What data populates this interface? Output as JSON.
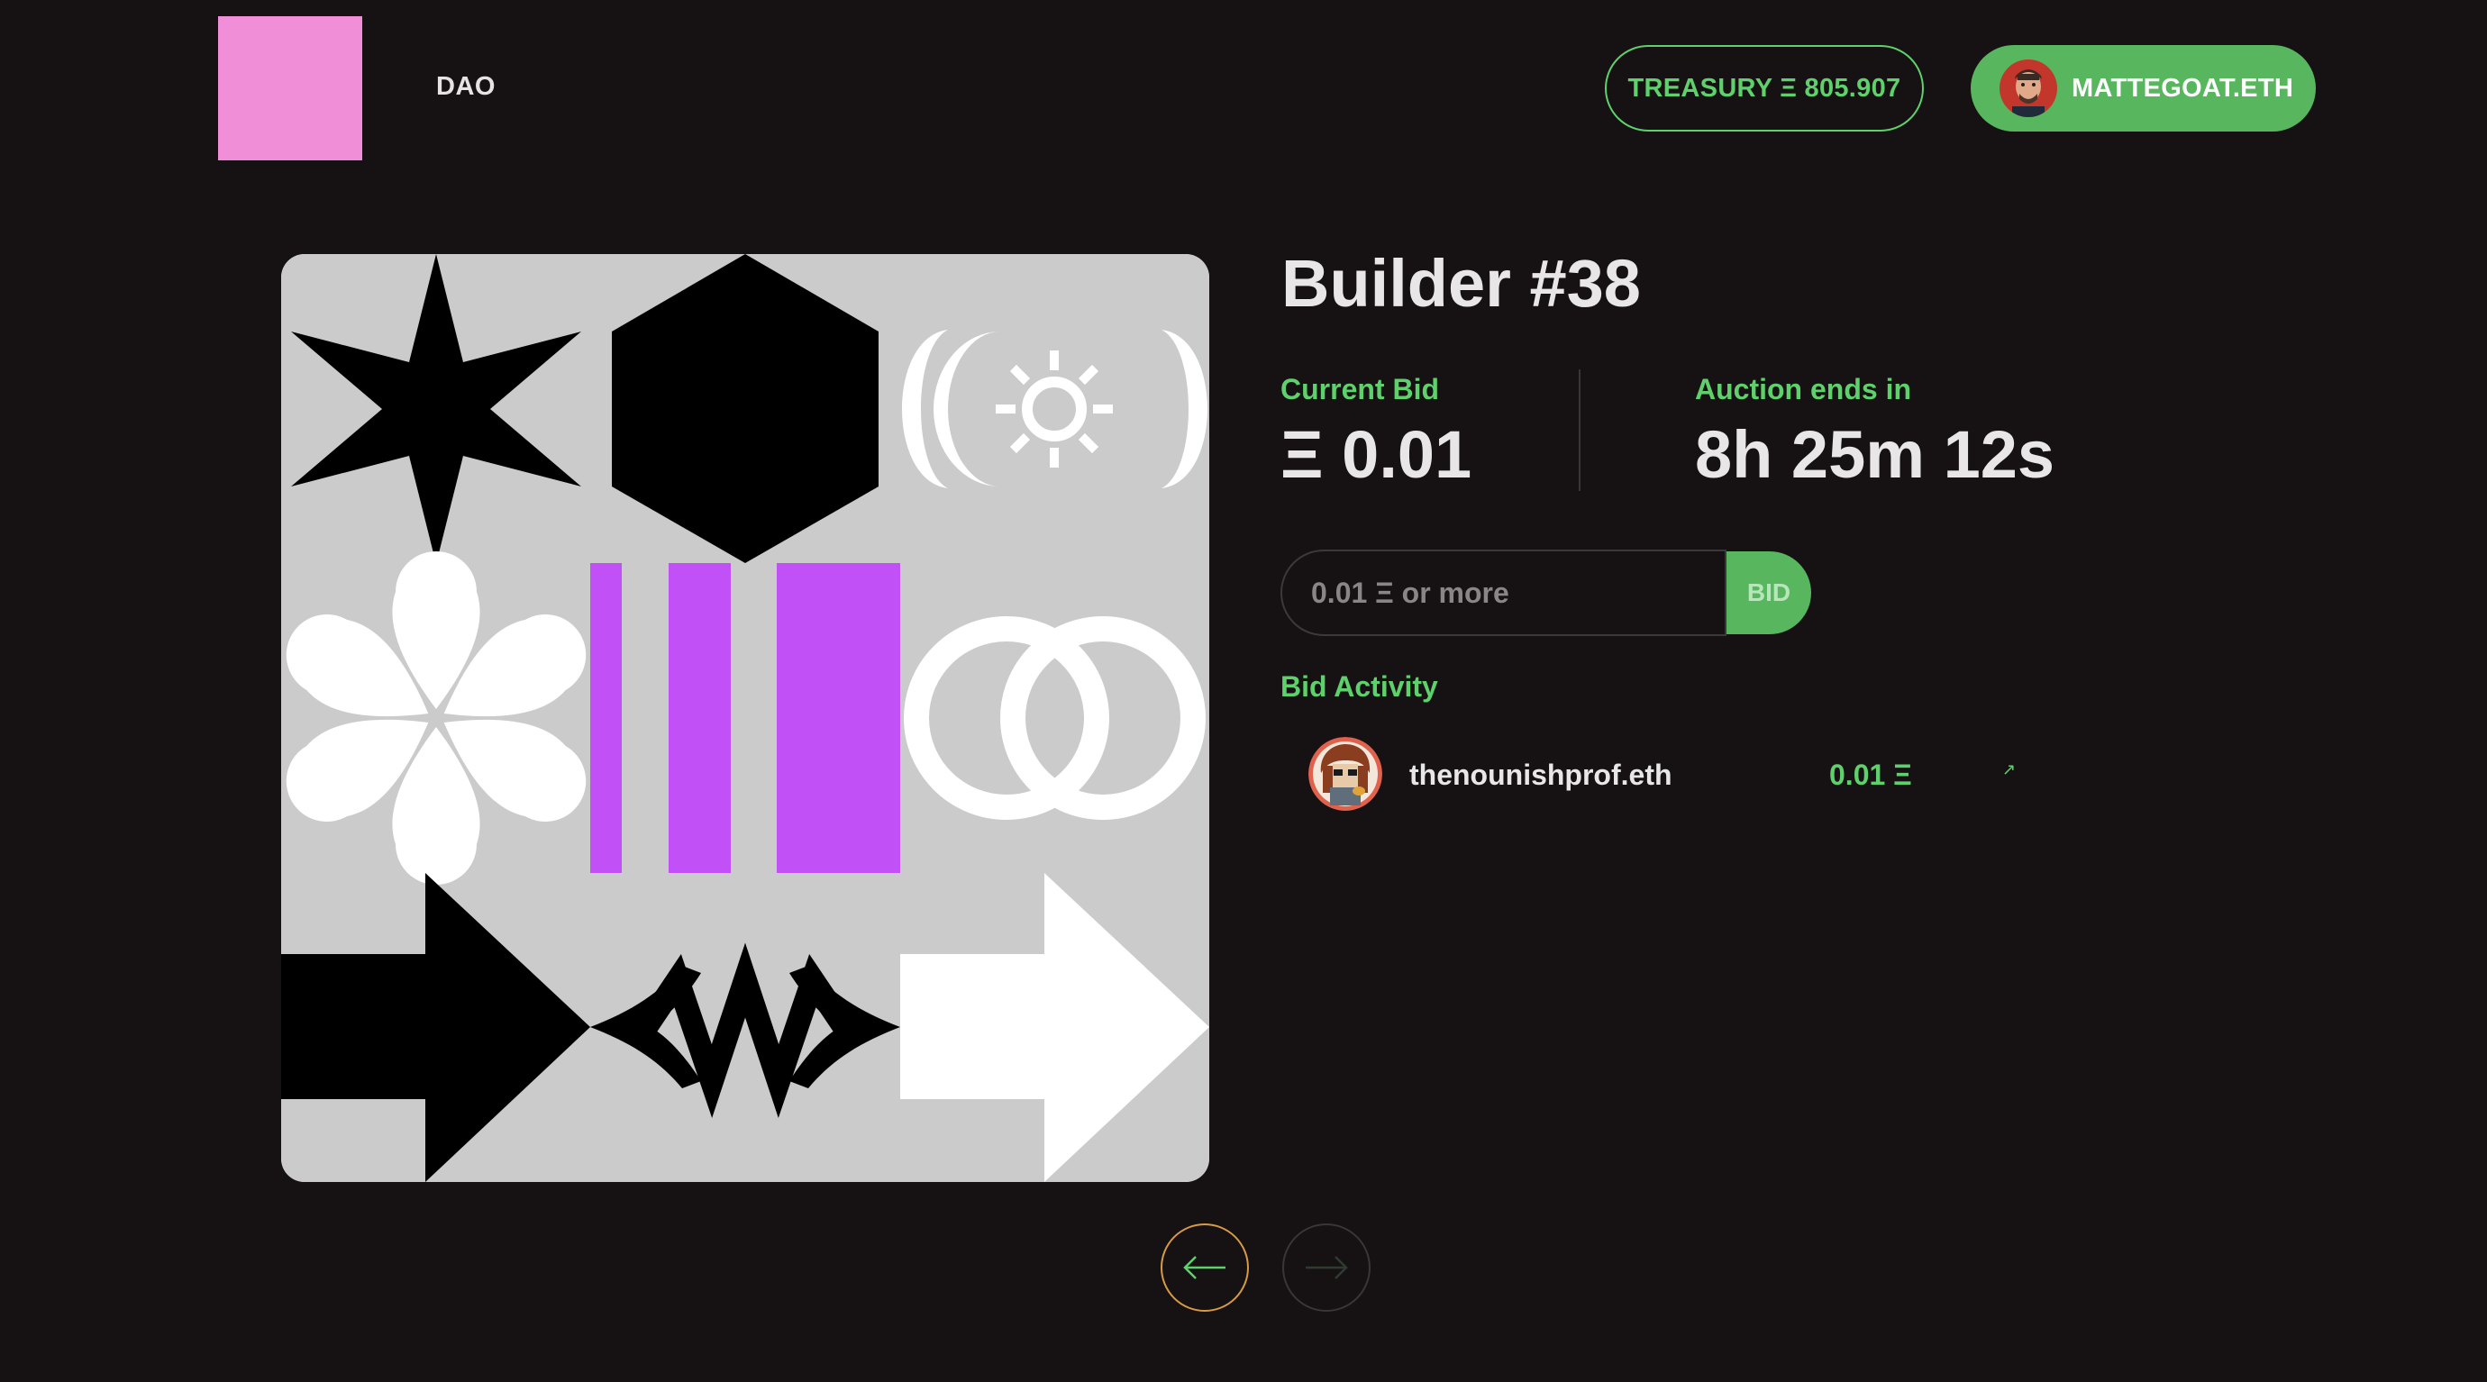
{
  "header": {
    "logo_color": "#f08fd8",
    "nav_label": "DAO",
    "treasury_label": "TREASURY Ξ 805.907",
    "account_label": "MATTEGOAT.ETH"
  },
  "auction": {
    "title": "Builder #38",
    "current_bid_label": "Current Bid",
    "current_bid_value": "Ξ 0.01",
    "ends_label": "Auction ends in",
    "ends_value": "8h 25m 12s",
    "bid_placeholder": "0.01 Ξ or more",
    "bid_button_label": "BID"
  },
  "activity": {
    "title": "Bid Activity",
    "bids": [
      {
        "bidder": "thenounishprof.eth",
        "amount": "0.01 Ξ",
        "link_icon": "↗"
      }
    ]
  },
  "pager": {
    "prev_icon": "arrow-left-icon",
    "next_icon": "arrow-right-icon"
  },
  "colors": {
    "background": "#161213",
    "accent_green": "#5fd16c",
    "button_green": "#58b65f",
    "artwork_bg": "#cbcbcb",
    "artwork_purple": "#c150f7",
    "prev_border": "#d79a45"
  }
}
